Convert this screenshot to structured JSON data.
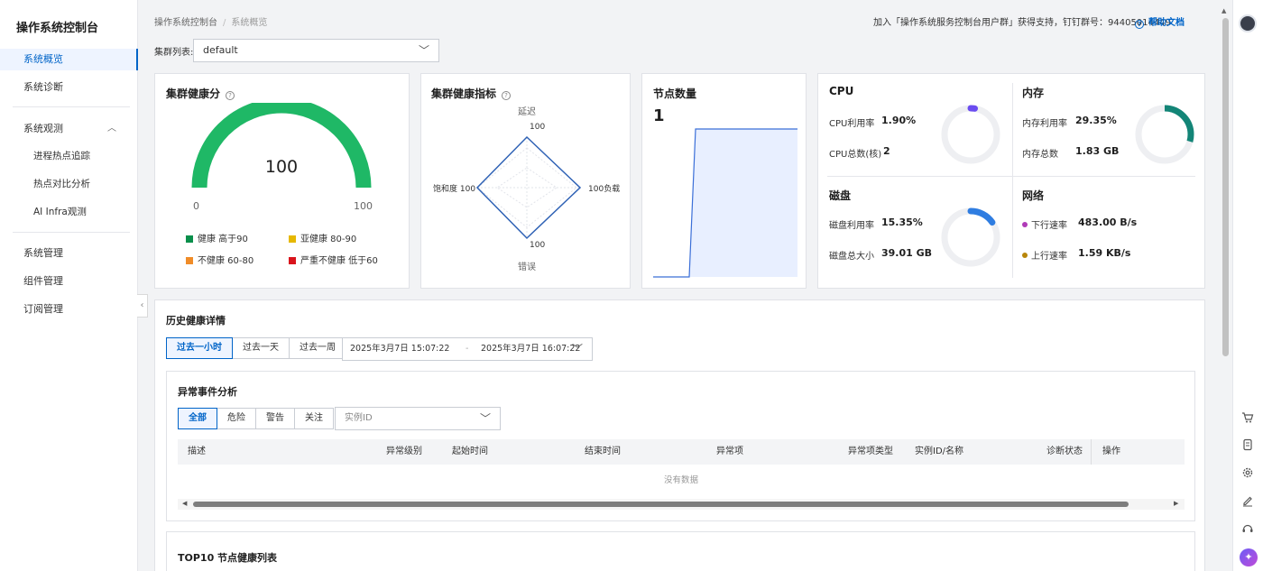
{
  "sidebar": {
    "title": "操作系统控制台",
    "items": [
      {
        "label": "系统概览",
        "active": true
      },
      {
        "label": "系统诊断"
      },
      {
        "label": "系统观测"
      },
      {
        "label": "进程热点追踪"
      },
      {
        "label": "热点对比分析"
      },
      {
        "label": "AI Infra观测"
      },
      {
        "label": "系统管理"
      },
      {
        "label": "组件管理"
      },
      {
        "label": "订阅管理"
      }
    ]
  },
  "header": {
    "breadcrumb": [
      "操作系统控制台",
      "系统概览"
    ],
    "support_text": "加入「操作系统服务控制台用户群」获得支持，钉钉群号：94405014449",
    "help_label": "帮助文档"
  },
  "cluster": {
    "label": "集群列表:",
    "value": "default"
  },
  "health_score": {
    "title": "集群健康分",
    "value": "100",
    "min": "0",
    "max": "100",
    "fraction": 1.0,
    "legend": [
      {
        "label": "健康 高于90",
        "color": "#0a8f4b"
      },
      {
        "label": "亚健康 80-90",
        "color": "#e6b800"
      },
      {
        "label": "不健康 60-80",
        "color": "#f08c28"
      },
      {
        "label": "严重不健康 低于60",
        "color": "#d9141c"
      }
    ]
  },
  "health_metrics": {
    "title": "集群健康指标",
    "axes": [
      {
        "name": "延迟",
        "value": "100"
      },
      {
        "name": "负载",
        "value": "100"
      },
      {
        "name": "错误",
        "value": "100"
      },
      {
        "name": "饱和度",
        "value": "100"
      }
    ]
  },
  "node_count": {
    "title": "节点数量",
    "value": "1"
  },
  "resources": {
    "cpu": {
      "title": "CPU",
      "usage_label": "CPU利用率",
      "usage_value": "1.90%",
      "usage": 0.019,
      "count_label": "CPU总数(核)",
      "count_value": "2"
    },
    "memory": {
      "title": "内存",
      "usage_label": "内存利用率",
      "usage_value": "29.35%",
      "usage": 0.2935,
      "total_label": "内存总数",
      "total_value": "1.83 GB"
    },
    "disk": {
      "title": "磁盘",
      "usage_label": "磁盘利用率",
      "usage_value": "15.35%",
      "usage": 0.1535,
      "total_label": "磁盘总大小",
      "total_value": "39.01 GB"
    },
    "network": {
      "title": "网络",
      "down_label": "下行速率",
      "down_value": "483.00 B/s",
      "up_label": "上行速率",
      "up_value": "1.59 KB/s"
    }
  },
  "history": {
    "title": "历史健康详情",
    "ranges": [
      "过去一小时",
      "过去一天",
      "过去一周"
    ],
    "start": "2025年3月7日 15:07:22",
    "sep": "-",
    "end": "2025年3月7日 16:07:22"
  },
  "anomaly": {
    "title": "异常事件分析",
    "filters": [
      "全部",
      "危险",
      "警告",
      "关注"
    ],
    "instance_placeholder": "实例ID",
    "columns": [
      "描述",
      "异常级别",
      "起始时间",
      "结束时间",
      "异常项",
      "异常项类型",
      "实例ID/名称",
      "诊断状态",
      "操作"
    ],
    "empty_text": "没有数据"
  },
  "top10": {
    "title": "TOP10 节点健康列表"
  },
  "colors": {
    "accent": "#0064c8",
    "gauge": "#1fb866",
    "cpu": "#6a4cf0",
    "memory": "#138577",
    "disk": "#2f7de1",
    "net_down": "#b03bb8",
    "net_up": "#b8860b"
  }
}
